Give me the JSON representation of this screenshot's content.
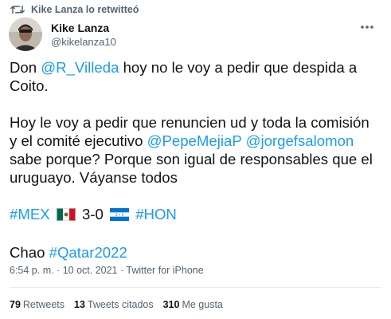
{
  "retweet": {
    "text": "Kike Lanza lo retwitteó",
    "icon": "retweet-icon"
  },
  "author": {
    "display_name": "Kike Lanza",
    "handle": "@kikelanza10"
  },
  "tweet": {
    "p1_prefix": "Don ",
    "p1_mention": "@R_Villeda",
    "p1_suffix": " hoy no le voy a pedir que despida a Coito.",
    "p2_line1": "Hoy le voy a pedir que renuncien ud y toda la comisión",
    "p2_pre": "y el comité ejecutivo ",
    "p2_mention1": "@PepeMejiaP",
    "p2_space": " ",
    "p2_mention2": "@jorgefsalomon",
    "p2_rest": "sabe porque? Porque son igual de responsables que el uruguayo. Váyanse todos",
    "score_tag1": "#MEX",
    "score_text": "3-0",
    "score_tag2": "#HON",
    "chao_text": "Chao ",
    "chao_tag": "#Qatar2022"
  },
  "meta": {
    "time": "6:54 p. m.",
    "sep": " · ",
    "date": "10 oct. 2021",
    "source": "Twitter for iPhone"
  },
  "stats": {
    "retweets_count": "79",
    "retweets_label": "Retweets",
    "quotes_count": "13",
    "quotes_label": "Tweets citados",
    "likes_count": "310",
    "likes_label": "Me gusta"
  },
  "colors": {
    "link": "#1d9bf0",
    "secondary": "#536471",
    "text": "#0f1419",
    "divider": "#e6ecf0"
  }
}
